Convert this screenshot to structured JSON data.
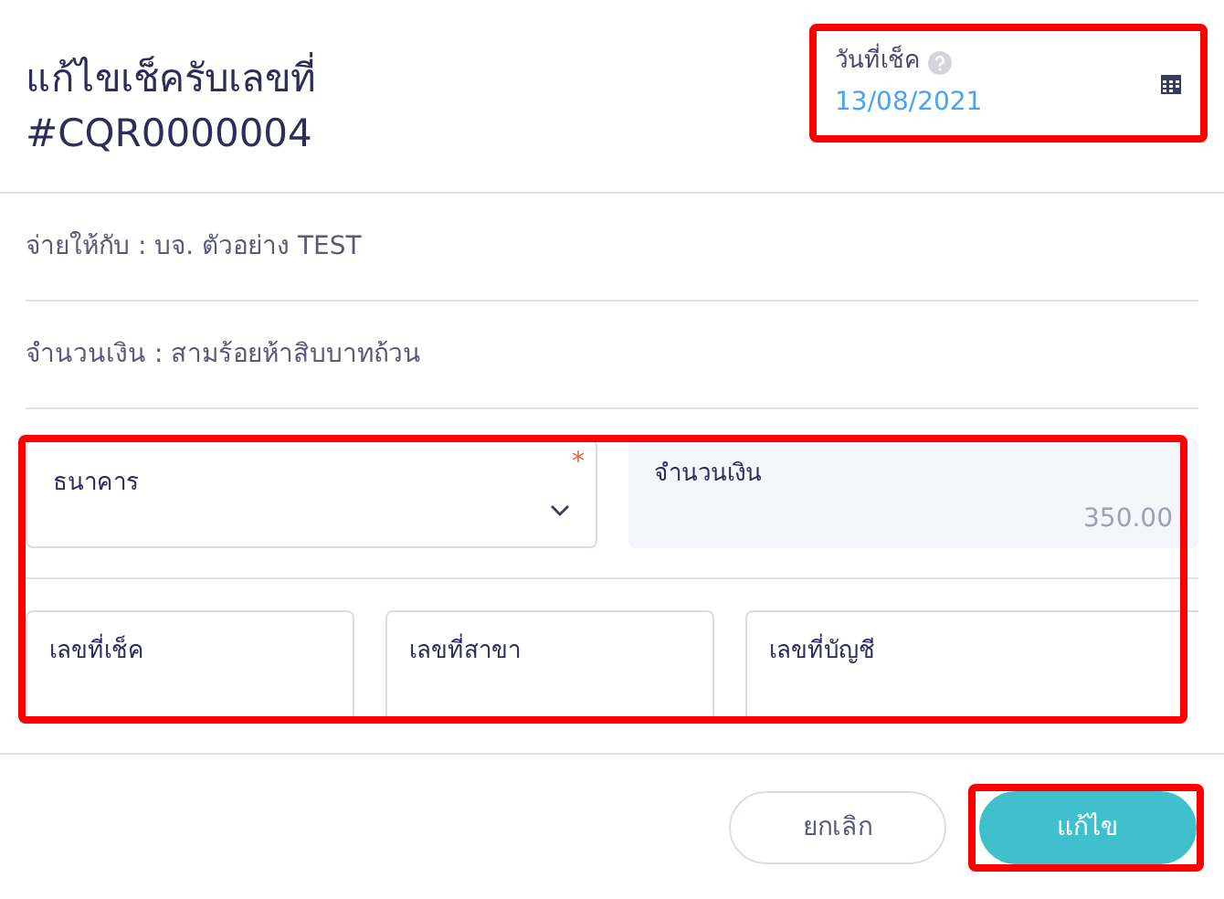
{
  "title": {
    "line_1": "แก้ไขเช็ครับเลขที่",
    "line_2": "#CQR0000004"
  },
  "date_field": {
    "label": "วันที่เช็ค",
    "value": "13/08/2021",
    "highlighted": true
  },
  "info_rows": [
    "จ่ายให้กับ : บจ. ตัวอย่าง TEST",
    "จำนวนเงิน : สามร้อยห้าสิบบาทถ้วน"
  ],
  "form": {
    "highlighted": true,
    "bank_field": {
      "label": "ธนาคาร",
      "required_mark": "*"
    },
    "amount_field": {
      "label": "จำนวนเงิน",
      "value": "350.00",
      "disabled": true
    },
    "fields": [
      {
        "label": "เลขที่เช็ค"
      },
      {
        "label": "เลขที่สาขา"
      },
      {
        "label": "เลขที่บัญชี"
      }
    ]
  },
  "buttons": [
    {
      "label": "ยกเลิก",
      "kind": "secondary",
      "highlighted": false
    },
    {
      "label": "แก้ไข",
      "kind": "primary",
      "highlighted": true
    }
  ]
}
